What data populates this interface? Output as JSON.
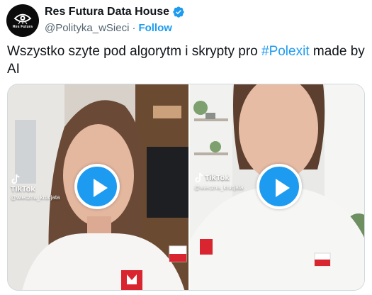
{
  "tweet": {
    "author": {
      "display_name": "Res Futura Data House",
      "handle": "@Polityka_wSieci",
      "separator": "·",
      "follow_label": "Follow",
      "avatar_text": "Res Futura",
      "verified": true
    },
    "text_before": "Wszystko szyte pod algorytm i skrypty pro ",
    "hashtag": "#Polexit",
    "text_after": " made by AI",
    "media": [
      {
        "watermark": "TikTok",
        "username": "@wieczna_krucjata",
        "play_icon": "play-icon"
      },
      {
        "watermark": "TikTok",
        "username": "@wieczna_krucjata",
        "play_icon": "play-icon"
      }
    ]
  },
  "colors": {
    "accent": "#1d9bf0",
    "text": "#0f1419",
    "secondary": "#536471",
    "border": "#cfd9de"
  }
}
